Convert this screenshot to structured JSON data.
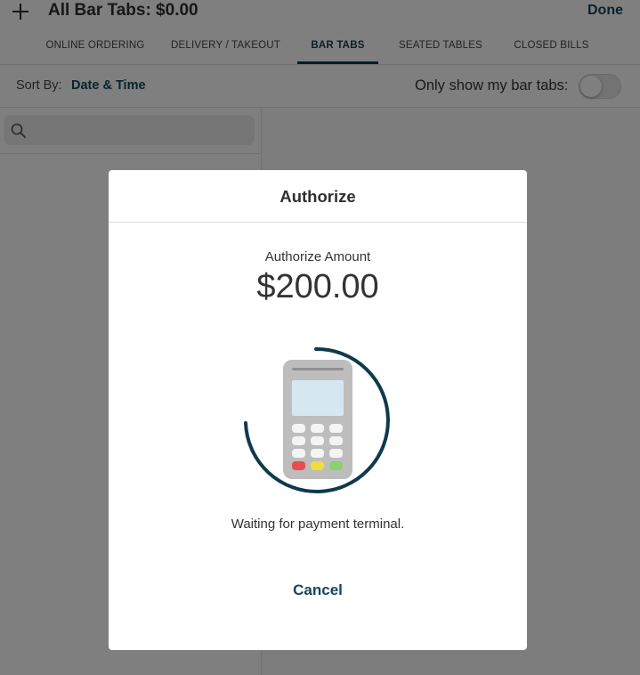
{
  "header": {
    "title": "All Bar Tabs: $0.00",
    "done_label": "Done"
  },
  "tabs": [
    {
      "label": "ONLINE ORDERING"
    },
    {
      "label": "DELIVERY / TAKEOUT"
    },
    {
      "label": "BAR TABS",
      "active": true
    },
    {
      "label": "SEATED TABLES"
    },
    {
      "label": "CLOSED BILLS"
    }
  ],
  "sortbar": {
    "sort_label": "Sort By:",
    "sort_value": "Date & Time",
    "my_tabs_label": "Only show my bar tabs:",
    "my_tabs_enabled": false
  },
  "search": {
    "value": "",
    "placeholder": ""
  },
  "modal": {
    "title": "Authorize",
    "amount_label": "Authorize Amount",
    "amount_value": "$200.00",
    "status_text": "Waiting for payment terminal.",
    "cancel_label": "Cancel",
    "graphic_icon": "card-terminal-icon",
    "spinner_icon": "loading-spinner-icon"
  },
  "colors": {
    "accent": "#14465a",
    "spinner": "#0e3a4c",
    "overlay": "rgba(0,0,0,0.5)",
    "key_red": "#e84c4f",
    "key_yellow": "#f2dd3a",
    "key_green": "#8bd16f"
  }
}
